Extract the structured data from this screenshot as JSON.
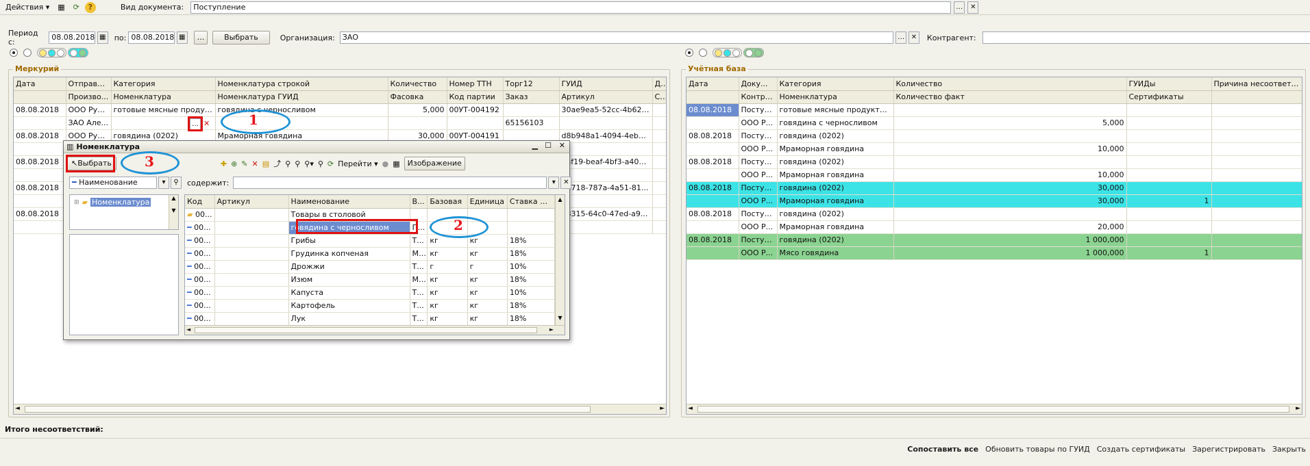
{
  "menu": {
    "actions_label": "Действия ▾",
    "doc_type_label": "Вид документа:",
    "doc_type_value": "Поступление"
  },
  "filters": {
    "period_from_label": "Период с:",
    "period_from": "08.08.2018",
    "period_to_label": "по:",
    "period_to": "08.08.2018",
    "dots": "...",
    "select_btn": "Выбрать",
    "org_label": "Организация:",
    "org_value": "ЗАО",
    "contractor_label": "Контрагент:",
    "contractor_value": ""
  },
  "mercury": {
    "title": "Меркурий",
    "headers1": [
      "Дата",
      "Отправи...",
      "Категория",
      "Номенклатура строкой",
      "Количество",
      "Номер ТТН",
      "Торг12",
      "ГУИД",
      "Доку"
    ],
    "headers2": [
      "",
      "Произво...",
      "Номенклатура",
      "Номенклатура ГУИД",
      "Фасовка",
      "Код партии",
      "Заказ",
      "Артикул",
      "Серт"
    ],
    "rows": [
      [
        "08.08.2018",
        "ООО Рус...",
        "готовые мясные продукт...",
        "говядина с черносливом",
        "5,000",
        "00УТ-004192",
        "",
        "30ae9ea5-52cc-4b62-b9...",
        ""
      ],
      [
        "",
        "ЗАО Але...",
        "",
        "",
        "",
        "",
        "65156103",
        "",
        ""
      ],
      [
        "08.08.2018",
        "ООО Рус...",
        "говядина (0202)",
        "Мраморная говядина",
        "30,000",
        "00УТ-004191",
        "",
        "d8b948a1-4094-4eb6-bfc...",
        ""
      ],
      [
        "",
        "",
        "",
        "",
        "",
        "",
        "",
        "",
        ""
      ],
      [
        "08.08.2018",
        "",
        "",
        "",
        "",
        "",
        "",
        "daf19-beaf-4bf3-a40a...",
        ""
      ],
      [
        "",
        "",
        "",
        "",
        "",
        "",
        "",
        "",
        ""
      ],
      [
        "08.08.2018",
        "",
        "",
        "",
        "",
        "",
        "",
        "d1718-787a-4a51-81...",
        ""
      ],
      [
        "",
        "",
        "",
        "",
        "",
        "",
        "",
        "",
        ""
      ],
      [
        "08.08.2018",
        "",
        "",
        "",
        "",
        "",
        "",
        "b8315-64c0-47ed-a9...",
        ""
      ],
      [
        "",
        "",
        "",
        "",
        "",
        "",
        "",
        "",
        ""
      ]
    ]
  },
  "uchet": {
    "title": "Учётная база",
    "headers1": [
      "Дата",
      "Доку...",
      "Категория",
      "Количество",
      "ГУИДы",
      "Причина несоответствия"
    ],
    "headers2": [
      "",
      "Контра...",
      "Номенклатура",
      "Количество факт",
      "Сертификаты",
      ""
    ],
    "rows": [
      [
        "08.08.2018",
        "Поступ...",
        "готовые мясные продукты (1...",
        "",
        "",
        ""
      ],
      [
        "",
        "ООО Р...",
        "говядина с черносливом",
        "5,000",
        "",
        ""
      ],
      [
        "08.08.2018",
        "Поступ...",
        "говядина (0202)",
        "",
        "",
        ""
      ],
      [
        "",
        "ООО Р...",
        "Мраморная говядина",
        "10,000",
        "",
        ""
      ],
      [
        "08.08.2018",
        "Поступ...",
        "говядина (0202)",
        "",
        "",
        ""
      ],
      [
        "",
        "ООО Р...",
        "Мраморная говядина",
        "10,000",
        "",
        ""
      ],
      [
        "08.08.2018",
        "Поступ...",
        "говядина (0202)",
        "30,000",
        "",
        ""
      ],
      [
        "",
        "ООО Р...",
        "Мраморная говядина",
        "30,000",
        "1",
        ""
      ],
      [
        "08.08.2018",
        "Поступ...",
        "говядина (0202)",
        "",
        "",
        ""
      ],
      [
        "",
        "ООО Р...",
        "Мраморная говядина",
        "20,000",
        "",
        ""
      ],
      [
        "08.08.2018",
        "Поступ...",
        "говядина (0202)",
        "1 000,000",
        "",
        ""
      ],
      [
        "",
        "ООО Р...",
        "Мясо говядина",
        "1 000,000",
        "1",
        ""
      ]
    ]
  },
  "dialog": {
    "title": "Номенклатура",
    "select_btn": "Выбрать",
    "goto_btn": "Перейти ▾",
    "image_btn": "Изображение",
    "search_field": "Наименование",
    "contains_label": "содержит:",
    "tree_root": "Номенклатура",
    "headers": [
      "Код",
      "Артикул",
      "Наименование",
      "В...",
      "Базовая",
      "Единица",
      "Ставка НДС"
    ],
    "rows": [
      [
        "00...",
        "",
        "Товары в столовой",
        "",
        "",
        "",
        ""
      ],
      [
        "00...",
        "",
        "говядина с черносливом",
        "П...",
        "",
        "",
        ""
      ],
      [
        "00...",
        "",
        "Грибы",
        "Т...",
        "кг",
        "кг",
        "18%"
      ],
      [
        "00...",
        "",
        "Грудинка копченая",
        "М...",
        "кг",
        "кг",
        "18%"
      ],
      [
        "00...",
        "",
        "Дрожжи",
        "Т...",
        "г",
        "г",
        "10%"
      ],
      [
        "00...",
        "",
        "Изюм",
        "М...",
        "кг",
        "кг",
        "18%"
      ],
      [
        "00...",
        "",
        "Капуста",
        "Т...",
        "кг",
        "кг",
        "10%"
      ],
      [
        "00...",
        "",
        "Картофель",
        "Т...",
        "кг",
        "кг",
        "18%"
      ],
      [
        "00...",
        "",
        "Лук",
        "Т...",
        "кг",
        "кг",
        "18%"
      ]
    ]
  },
  "annotations": {
    "n1": "1",
    "n2": "2",
    "n3": "3"
  },
  "footer": {
    "total_label": "Итого несоответствий:",
    "actions": [
      "Сопоставить все",
      "Обновить товары по ГУИД",
      "Создать сертификаты",
      "Зарегистрировать",
      "Закрыть"
    ]
  }
}
